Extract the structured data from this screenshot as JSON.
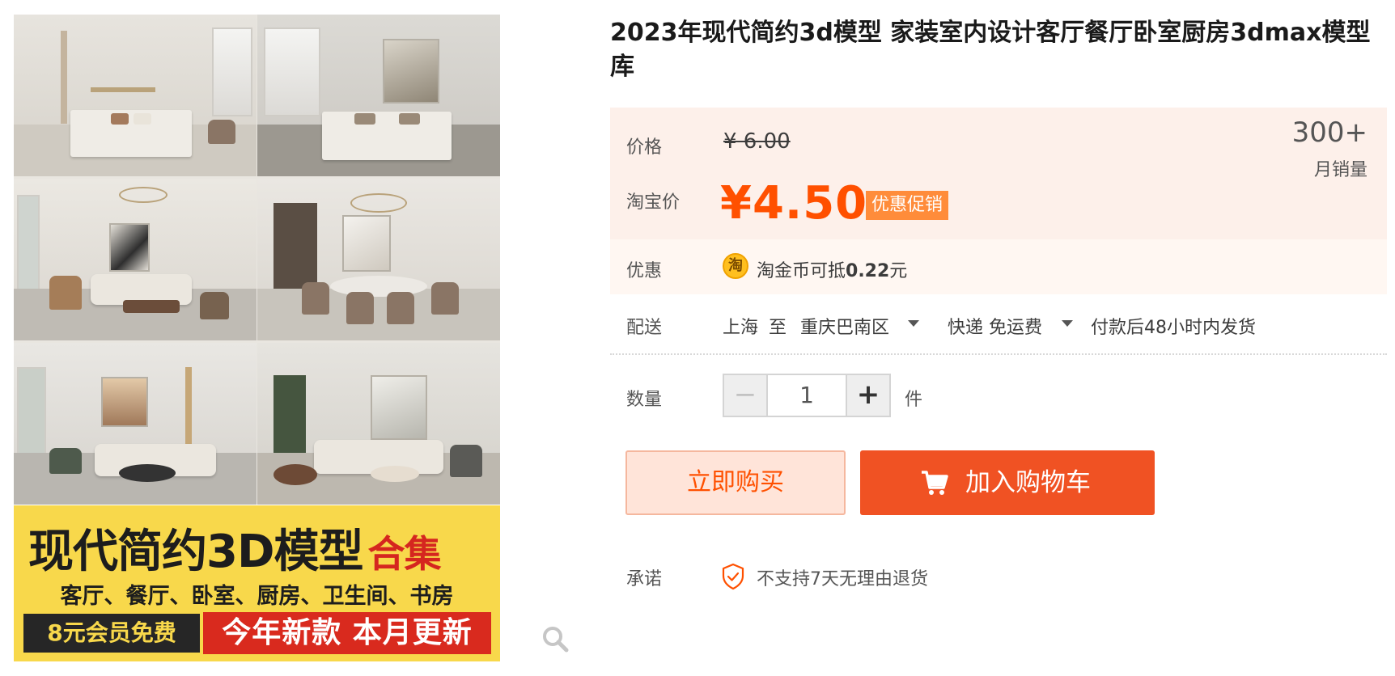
{
  "product": {
    "title": "2023年现代简约3d模型 家装室内设计客厅餐厅卧室厨房3dmax模型库"
  },
  "gallery": {
    "banner_title": "现代简约3D模型",
    "banner_title_accent": "合集",
    "banner_subtitle": "客厅、餐厅、卧室、厨房、卫生间、书房",
    "banner_left_tag": "8元会员免费",
    "banner_right_tag": "今年新款 本月更新",
    "zoom_icon": "search-icon"
  },
  "price": {
    "price_label": "价格",
    "original_price": "¥ 6.00",
    "taobao_price_label": "淘宝价",
    "current_price": "¥4.50",
    "promo_tag": "优惠促销",
    "monthly_sales_count": "300+",
    "monthly_sales_label": "月销量",
    "accent_color": "#ff5000"
  },
  "discount": {
    "label": "优惠",
    "coin_icon": "淘",
    "text_prefix": "淘金币可抵",
    "amount": "0.22",
    "text_suffix": "元"
  },
  "shipping": {
    "label": "配送",
    "from": "上海",
    "to_word": "至",
    "destination": "重庆巴南区",
    "method": "快递",
    "fee": "免运费",
    "dispatch_note": "付款后48小时内发货"
  },
  "quantity": {
    "label": "数量",
    "minus": "−",
    "value": "1",
    "plus": "+",
    "unit": "件"
  },
  "actions": {
    "buy_now": "立即购买",
    "add_to_cart": "加入购物车",
    "cart_button_color": "#f05223"
  },
  "promise": {
    "label": "承诺",
    "text": "不支持7天无理由退货"
  }
}
